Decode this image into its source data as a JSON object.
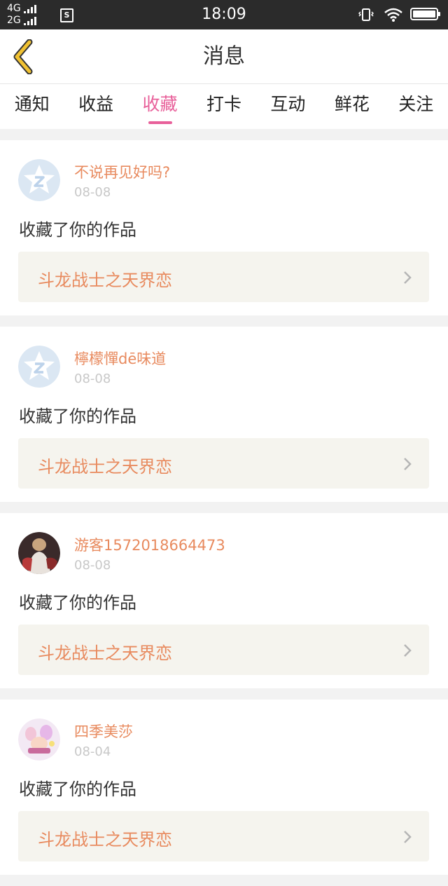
{
  "status_bar": {
    "network_top": "4G",
    "network_bottom": "2G",
    "sim_label": "S",
    "time": "18:09"
  },
  "header": {
    "title": "消息"
  },
  "tabs": [
    {
      "label": "通知",
      "active": false
    },
    {
      "label": "收益",
      "active": false
    },
    {
      "label": "收藏",
      "active": true
    },
    {
      "label": "打卡",
      "active": false
    },
    {
      "label": "互动",
      "active": false
    },
    {
      "label": "鲜花",
      "active": false
    },
    {
      "label": "关注",
      "active": false
    }
  ],
  "items": [
    {
      "username": "不说再见好吗?",
      "date": "08-08",
      "action": "收藏了你的作品",
      "work": "斗龙战士之天界恋",
      "avatar": "default-star"
    },
    {
      "username": "檸檬憚dē味道",
      "date": "08-08",
      "action": "收藏了你的作品",
      "work": "斗龙战士之天界恋",
      "avatar": "default-star"
    },
    {
      "username": "游客1572018664473",
      "date": "08-08",
      "action": "收藏了你的作品",
      "work": "斗龙战士之天界恋",
      "avatar": "photo"
    },
    {
      "username": "四季美莎",
      "date": "08-04",
      "action": "收藏了你的作品",
      "work": "斗龙战士之天界恋",
      "avatar": "illustration"
    }
  ],
  "colors": {
    "accent": "#e8609a",
    "username": "#e88a5e",
    "work_title": "#e88a5e",
    "back_icon": "#f1c232"
  }
}
